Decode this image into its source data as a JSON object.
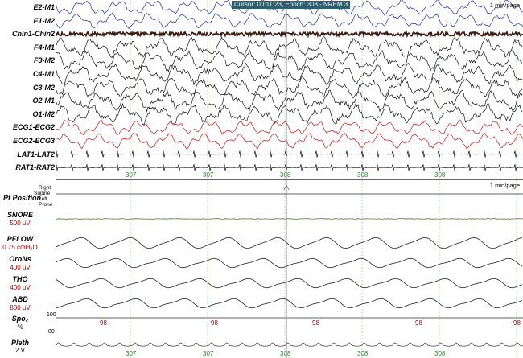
{
  "cursor_banner": "Cursor: 00:11:23, Epoch: 308 - NREM 3",
  "page_scale": "1 min/page",
  "top_channels": [
    {
      "label": "E2-M1",
      "color": "#1a2fb0"
    },
    {
      "label": "E1-M2",
      "color": "#1a2fb0"
    },
    {
      "label": "Chin1-Chin2",
      "color": "#3a1a10"
    },
    {
      "label": "F4-M1",
      "color": "#111111"
    },
    {
      "label": "F3-M2",
      "color": "#111111"
    },
    {
      "label": "C4-M1",
      "color": "#111111"
    },
    {
      "label": "C3-M2",
      "color": "#111111"
    },
    {
      "label": "O2-M1",
      "color": "#111111"
    },
    {
      "label": "O1-M2",
      "color": "#111111"
    },
    {
      "label": "ECG1-ECG2",
      "color": "#d01010"
    },
    {
      "label": "ECG2-ECG3",
      "color": "#d01010"
    },
    {
      "label": "LAT1-LAT2",
      "color": "#111111"
    },
    {
      "label": "RAT1-RAT2",
      "color": "#111111"
    }
  ],
  "epoch_labels": [
    "307",
    "307",
    "308",
    "308",
    "308"
  ],
  "pt_position": {
    "label": "Pt Position",
    "levels": [
      "Right",
      "Supine",
      "Left",
      "Prone"
    ]
  },
  "bottom_channels": [
    {
      "label": "SNORE",
      "sub": "500 uV"
    },
    {
      "label": "PFLOW",
      "sub": "0.75 cmH₂O"
    },
    {
      "label": "OroNs",
      "sub": "400 uV"
    },
    {
      "label": "THO",
      "sub": "400 uV"
    },
    {
      "label": "ABD",
      "sub": "800 uV"
    }
  ],
  "spo2": {
    "label": "Spo₂",
    "unit": "%",
    "scale_top": "100",
    "scale_bottom": "80",
    "values": [
      "98",
      "98",
      "98",
      "98",
      "98"
    ]
  },
  "pleth": {
    "label": "Pleth",
    "sub": "2 V"
  },
  "colors": {
    "grid": "#9fc89f",
    "cursor": "#888888",
    "banner": "#2d5f6e"
  }
}
